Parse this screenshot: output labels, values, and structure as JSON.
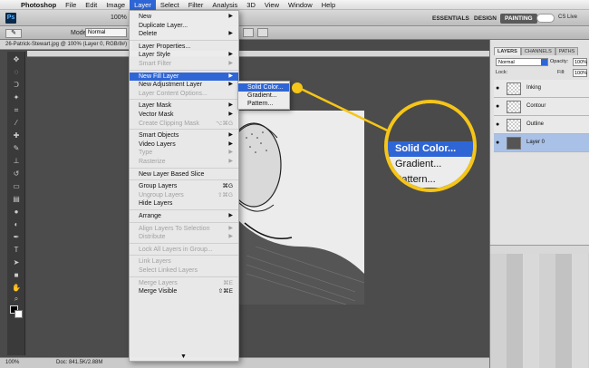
{
  "menubar": {
    "app": "Photoshop",
    "items": [
      "File",
      "Edit",
      "Image",
      "Layer",
      "Select",
      "Filter",
      "Analysis",
      "3D",
      "View",
      "Window",
      "Help"
    ],
    "active": "Layer"
  },
  "app_toolbar": {
    "logo": "Ps",
    "zoom": "100%",
    "workspaces": [
      "ESSENTIALS",
      "DESIGN",
      "PAINTING"
    ],
    "active_workspace": "PAINTING",
    "cs_live": "CS Live"
  },
  "options_bar": {
    "mode_label": "Mode:",
    "mode_value": "Normal",
    "brush_size": "5"
  },
  "document_tab": "26-Patrick-Stewart.jpg @ 100% (Layer 0, RGB/8#)",
  "status_bar": {
    "zoom": "100%",
    "doc": "Doc: 841.5K/2.88M"
  },
  "layer_menu": {
    "items": [
      {
        "label": "New",
        "arrow": true
      },
      {
        "label": "Duplicate Layer..."
      },
      {
        "label": "Delete",
        "arrow": true
      },
      {
        "sep": true
      },
      {
        "label": "Layer Properties..."
      },
      {
        "label": "Layer Style",
        "arrow": true
      },
      {
        "label": "Smart Filter",
        "arrow": true,
        "disabled": true
      },
      {
        "sep": true
      },
      {
        "label": "New Fill Layer",
        "arrow": true,
        "highlight": true
      },
      {
        "label": "New Adjustment Layer",
        "arrow": true
      },
      {
        "label": "Layer Content Options...",
        "disabled": true
      },
      {
        "sep": true
      },
      {
        "label": "Layer Mask",
        "arrow": true
      },
      {
        "label": "Vector Mask",
        "arrow": true
      },
      {
        "label": "Create Clipping Mask",
        "shortcut": "⌥⌘G",
        "disabled": true
      },
      {
        "sep": true
      },
      {
        "label": "Smart Objects",
        "arrow": true
      },
      {
        "label": "Video Layers",
        "arrow": true
      },
      {
        "label": "Type",
        "arrow": true,
        "disabled": true
      },
      {
        "label": "Rasterize",
        "arrow": true,
        "disabled": true
      },
      {
        "sep": true
      },
      {
        "label": "New Layer Based Slice"
      },
      {
        "sep": true
      },
      {
        "label": "Group Layers",
        "shortcut": "⌘G"
      },
      {
        "label": "Ungroup Layers",
        "shortcut": "⇧⌘G",
        "disabled": true
      },
      {
        "label": "Hide Layers"
      },
      {
        "sep": true
      },
      {
        "label": "Arrange",
        "arrow": true
      },
      {
        "sep": true
      },
      {
        "label": "Align Layers To Selection",
        "arrow": true,
        "disabled": true
      },
      {
        "label": "Distribute",
        "arrow": true,
        "disabled": true
      },
      {
        "sep": true
      },
      {
        "label": "Lock All Layers in Group...",
        "disabled": true
      },
      {
        "sep": true
      },
      {
        "label": "Link Layers",
        "disabled": true
      },
      {
        "label": "Select Linked Layers",
        "disabled": true
      },
      {
        "sep": true
      },
      {
        "label": "Merge Layers",
        "shortcut": "⌘E",
        "disabled": true
      },
      {
        "label": "Merge Visible",
        "shortcut": "⇧⌘E"
      }
    ],
    "scroll_indicator": "▼"
  },
  "fill_submenu": {
    "items": [
      "Solid Color...",
      "Gradient...",
      "Pattern..."
    ],
    "highlight": "Solid Color..."
  },
  "callout": {
    "items": [
      "Solid Color...",
      "Gradient...",
      "Pattern..."
    ],
    "color": "#f5c518"
  },
  "layers_panel": {
    "tabs": [
      "LAYERS",
      "CHANNELS",
      "PATHS"
    ],
    "active_tab": "LAYERS",
    "blend_mode": "Normal",
    "opacity_label": "Opacity:",
    "opacity": "100%",
    "lock_label": "Lock:",
    "fill_label": "Fill:",
    "fill": "100%",
    "layers": [
      {
        "name": "Inking",
        "selected": false
      },
      {
        "name": "Contour",
        "selected": false
      },
      {
        "name": "Outline",
        "selected": false
      },
      {
        "name": "Layer 0",
        "selected": true
      }
    ]
  },
  "colors": {
    "highlight": "#2f66d6",
    "callout": "#f5c518"
  }
}
